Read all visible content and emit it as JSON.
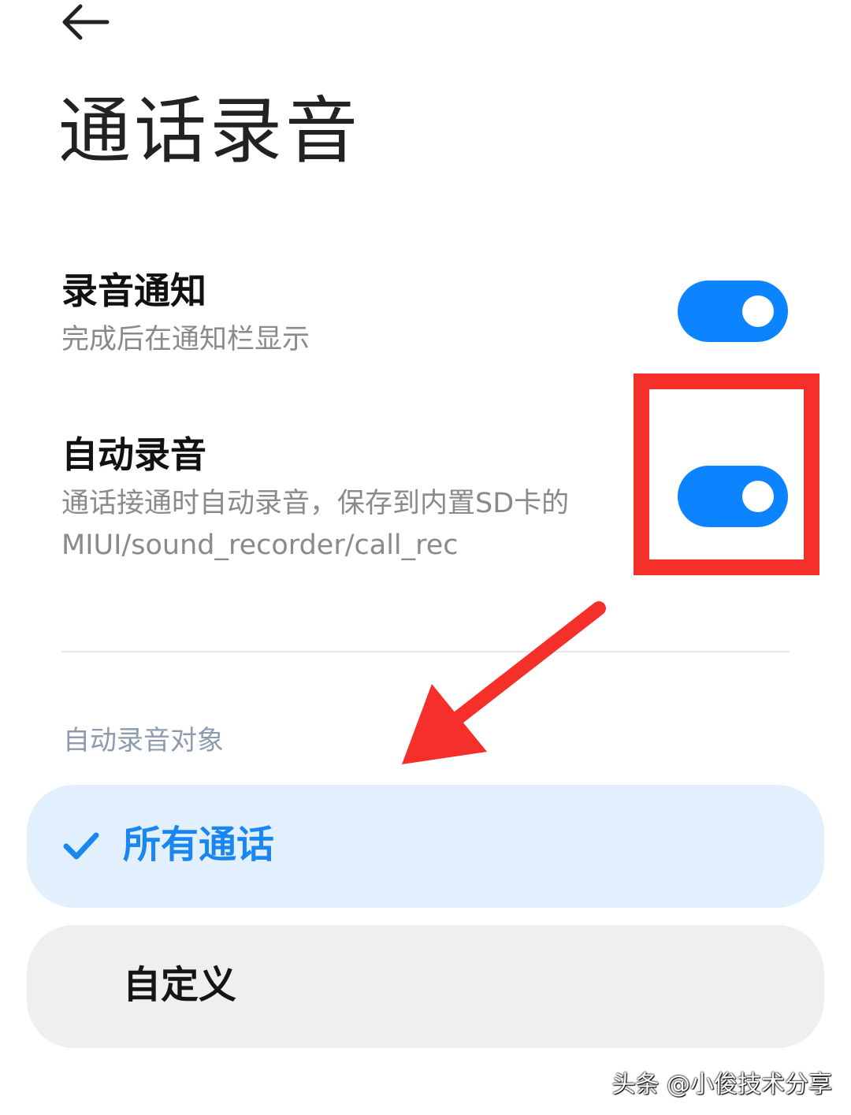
{
  "header": {
    "back_icon": "back-arrow-icon",
    "title": "通话录音"
  },
  "settings": [
    {
      "title": "录音通知",
      "description": "完成后在通知栏显示",
      "enabled": true
    },
    {
      "title": "自动录音",
      "description_line1": "通话接通时自动录音，保存到内置SD卡的",
      "description_line2": "MIUI/sound_recorder/call_rec",
      "enabled": true
    }
  ],
  "auto_record_target": {
    "section_label": "自动录音对象",
    "options": [
      {
        "label": "所有通话",
        "selected": true,
        "icon": "check-icon"
      },
      {
        "label": "自定义",
        "selected": false
      }
    ]
  },
  "annotation": {
    "highlight_color": "#f5302b",
    "arrow_icon": "red-arrow-annotation-icon"
  },
  "watermark": "头条 @小俊技术分享",
  "colors": {
    "accent": "#0d84ff",
    "selected_bg": "#e2f0fd",
    "unselected_bg": "#efefef",
    "section_label": "#8d9bb0"
  }
}
